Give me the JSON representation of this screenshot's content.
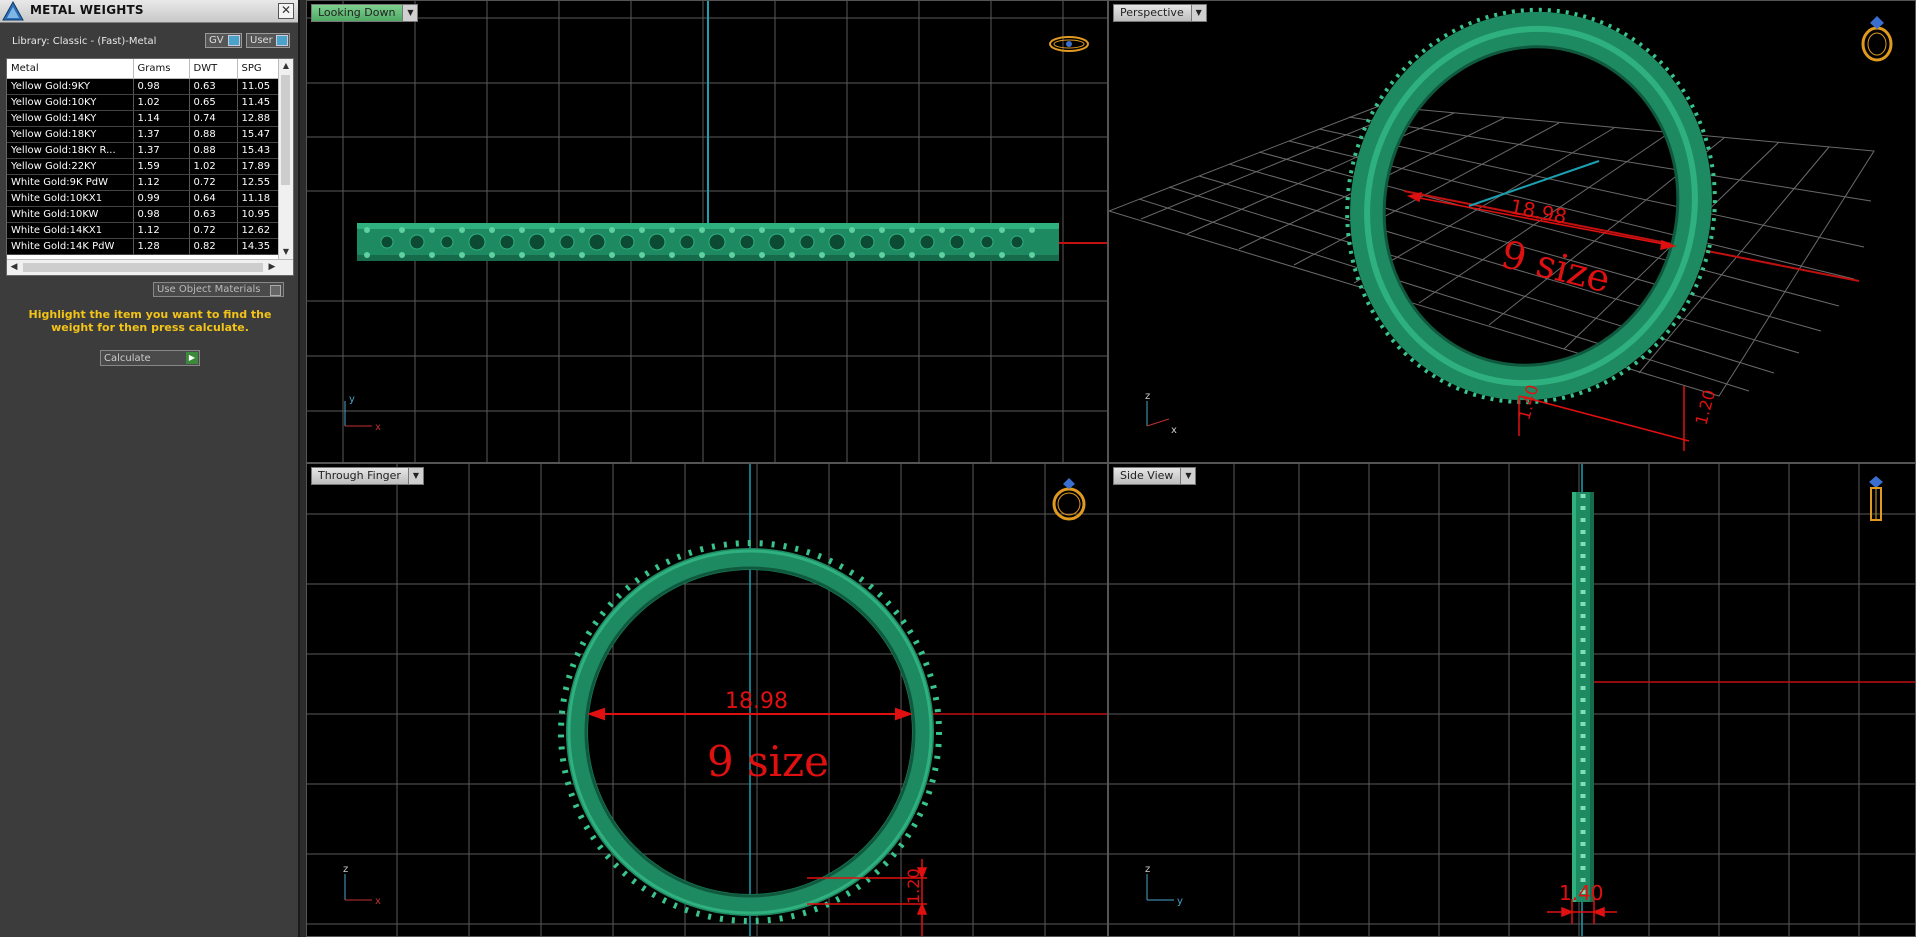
{
  "panel": {
    "title": "METAL WEIGHTS",
    "close_label": "✕",
    "library_label": "Library: Classic - (Fast)-Metal",
    "gv_label": "GV",
    "user_label": "User",
    "columns": [
      "Metal",
      "Grams",
      "DWT",
      "SPG"
    ],
    "rows": [
      {
        "metal": "Yellow Gold:9KY",
        "grams": "0.98",
        "dwt": "0.63",
        "spg": "11.05"
      },
      {
        "metal": "Yellow Gold:10KY",
        "grams": "1.02",
        "dwt": "0.65",
        "spg": "11.45"
      },
      {
        "metal": "Yellow Gold:14KY",
        "grams": "1.14",
        "dwt": "0.74",
        "spg": "12.88"
      },
      {
        "metal": "Yellow Gold:18KY",
        "grams": "1.37",
        "dwt": "0.88",
        "spg": "15.47"
      },
      {
        "metal": "Yellow Gold:18KY R...",
        "grams": "1.37",
        "dwt": "0.88",
        "spg": "15.43"
      },
      {
        "metal": "Yellow Gold:22KY",
        "grams": "1.59",
        "dwt": "1.02",
        "spg": "17.89"
      },
      {
        "metal": "White Gold:9K PdW",
        "grams": "1.12",
        "dwt": "0.72",
        "spg": "12.55"
      },
      {
        "metal": "White Gold:10KX1",
        "grams": "0.99",
        "dwt": "0.64",
        "spg": "11.18"
      },
      {
        "metal": "White Gold:10KW",
        "grams": "0.98",
        "dwt": "0.63",
        "spg": "10.95"
      },
      {
        "metal": "White Gold:14KX1",
        "grams": "1.12",
        "dwt": "0.72",
        "spg": "12.62"
      },
      {
        "metal": "White Gold:14K PdW",
        "grams": "1.28",
        "dwt": "0.82",
        "spg": "14.35"
      }
    ],
    "use_materials_label": "Use Object Materials",
    "instructions": "Highlight the item you want to find the weight for then press calculate.",
    "calculate_label": "Calculate"
  },
  "viewports": {
    "top": {
      "label": "Looking Down",
      "axis_a": "y",
      "axis_b": "x"
    },
    "perspective": {
      "label": "Perspective",
      "dim_width": "18.98",
      "size_text": "9 size",
      "dim_thickness": "1.40",
      "dim_height": "1.20",
      "axis_a": "z",
      "axis_b": "x"
    },
    "front": {
      "label": "Through Finger",
      "dim_width": "18.98",
      "size_text": "9 size",
      "dim_height": "1.20",
      "axis_a": "z",
      "axis_b": "x"
    },
    "side": {
      "label": "Side View",
      "dim_thickness": "1.40",
      "axis_a": "z",
      "axis_b": "y"
    }
  },
  "colors": {
    "ring": "#1e8a62",
    "ring_light": "#2fb07f",
    "dimension": "#e01010",
    "grid": "#5a5a5a",
    "axis_cyan": "#1aa0b0",
    "axis_red": "#c01010",
    "highlight_text": "#f2c318"
  }
}
